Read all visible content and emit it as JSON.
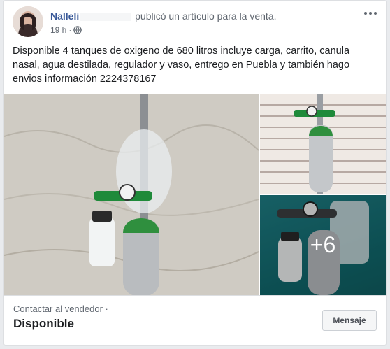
{
  "post": {
    "author_name": "Nalleli",
    "action_text": "publicó un artículo para la venta.",
    "time": "19 h",
    "audience_icon": "globe-icon",
    "body": "Disponible 4 tanques de oxigeno de 680 litros incluye carga, carrito, canula nasal, agua destilada, regulador y vaso, entrego en Puebla y también hago envios información 2224378167"
  },
  "gallery": {
    "more_count": "+6"
  },
  "footer": {
    "contact_label": "Contactar al vendedor ·",
    "status": "Disponible",
    "message_button": "Mensaje"
  },
  "colors": {
    "link": "#385898",
    "secondary_text": "#606770",
    "tank_green": "#2f8f3e"
  }
}
